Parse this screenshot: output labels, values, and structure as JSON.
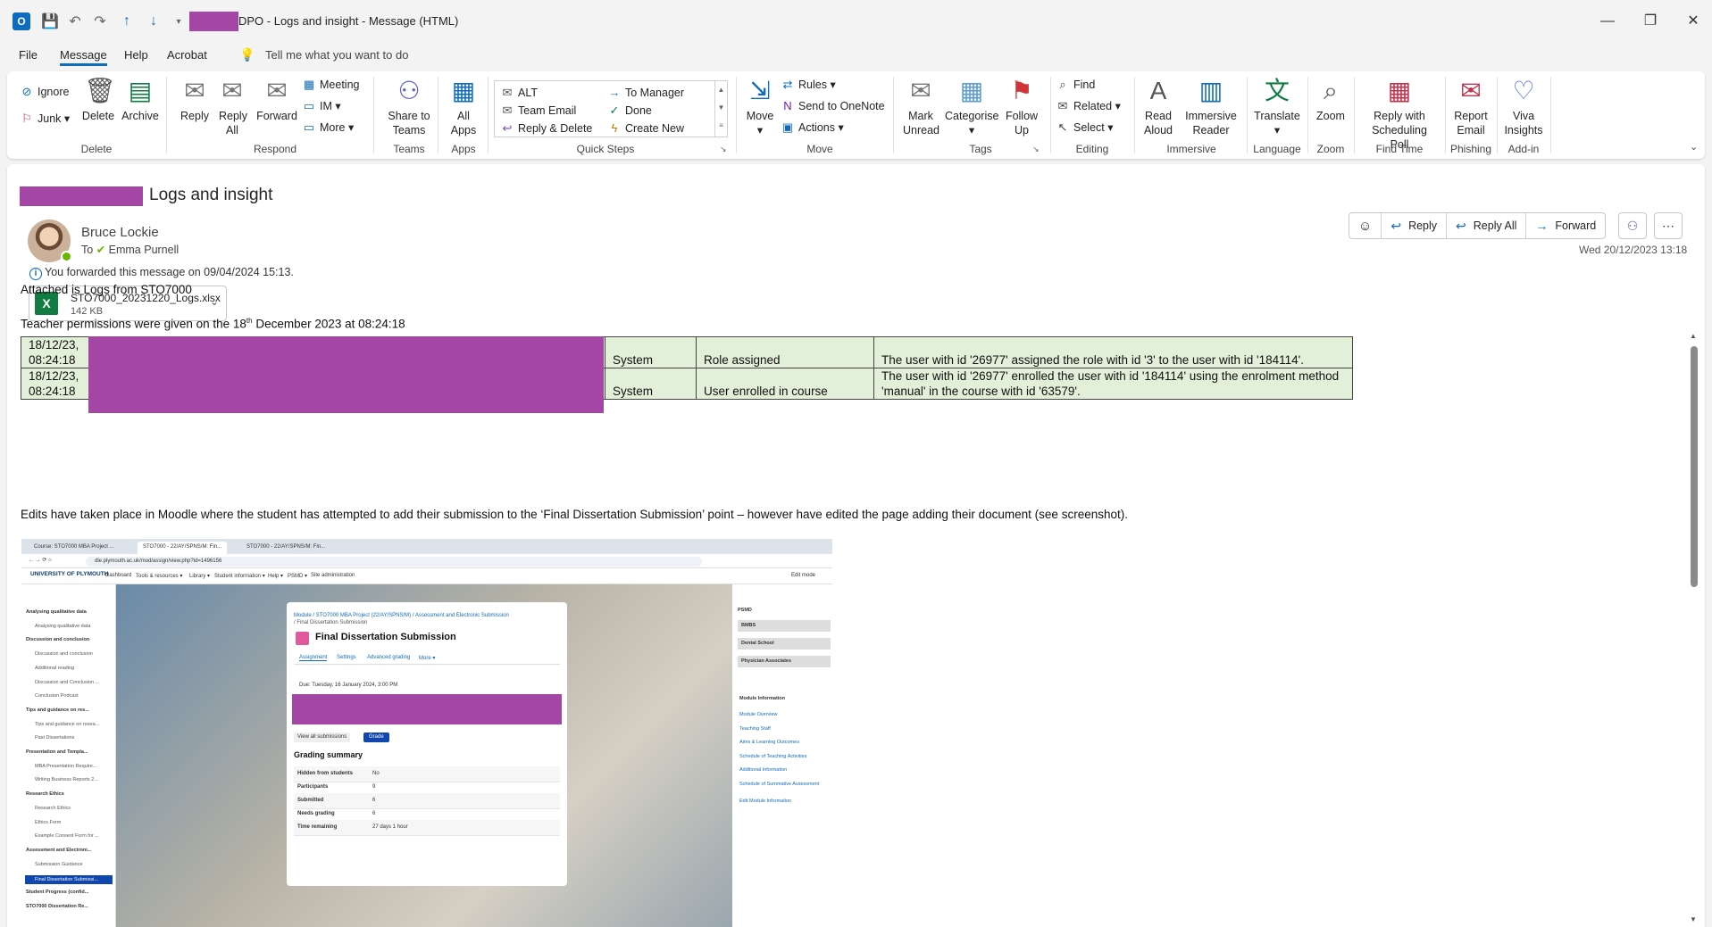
{
  "window": {
    "title": "DPO - Logs and insight  -  Message (HTML)",
    "controls": {
      "minimize": "—",
      "restore": "❐",
      "close": "✕"
    }
  },
  "menu": {
    "tabs": [
      "File",
      "Message",
      "Help",
      "Acrobat"
    ],
    "active": "Message",
    "tell_me": "Tell me what you want to do"
  },
  "ribbon": {
    "delete": {
      "ignore": "Ignore",
      "junk": "Junk",
      "delete": "Delete",
      "archive": "Archive",
      "label": "Delete"
    },
    "respond": {
      "reply": "Reply",
      "reply_all": "Reply All",
      "forward": "Forward",
      "meeting": "Meeting",
      "im": "IM",
      "more": "More",
      "label": "Respond"
    },
    "teams": {
      "share": "Share to Teams",
      "label": "Teams"
    },
    "apps": {
      "all_apps": "All Apps",
      "label": "Apps"
    },
    "quick_steps": {
      "items": [
        "ALT",
        "Team Email",
        "Reply & Delete",
        "To Manager",
        "Done",
        "Create New"
      ],
      "label": "Quick Steps"
    },
    "move": {
      "move": "Move",
      "rules": "Rules",
      "onenote": "Send to OneNote",
      "actions": "Actions",
      "label": "Move"
    },
    "tags": {
      "mark_unread": "Mark Unread",
      "categorise": "Categorise",
      "follow_up": "Follow Up",
      "label": "Tags"
    },
    "editing": {
      "find": "Find",
      "related": "Related",
      "select": "Select",
      "label": "Editing"
    },
    "immersive": {
      "read_aloud": "Read Aloud",
      "immersive_reader": "Immersive Reader",
      "label": "Immersive"
    },
    "language": {
      "translate": "Translate",
      "label": "Language"
    },
    "zoom": {
      "zoom": "Zoom",
      "label": "Zoom"
    },
    "find_time": {
      "poll": "Reply with Scheduling Poll",
      "label": "Find Time"
    },
    "phishing": {
      "report": "Report Email",
      "label": "Phishing"
    },
    "addin": {
      "viva": "Viva Insights",
      "label": "Add-in"
    }
  },
  "message": {
    "subject": "Logs and insight",
    "sender": "Bruce Lockie",
    "to_label": "To",
    "recipient": "Emma Purnell",
    "forwarded_note": "You forwarded this message on 09/04/2024 15:13.",
    "timestamp": "Wed 20/12/2023 13:18",
    "attachment": {
      "name": "STO7000_20231220_Logs.xlsx",
      "size": "142 KB"
    },
    "actions": {
      "reply": "Reply",
      "reply_all": "Reply All",
      "forward": "Forward"
    },
    "body": {
      "line1": "Attached is Logs from STO7000",
      "line2_pre": "Teacher permissions were given on the 18",
      "line2_sup": "th",
      "line2_post": " December 2023 at 08:24:18",
      "line3": "Edits have taken place in Moodle where the student has attempted to add their submission to the ‘Final Dissertation Submission’ point – however have edited the page adding their document (see screenshot)."
    },
    "log_rows": [
      {
        "time": "18/12/23, 08:24:18",
        "origin": "System",
        "event": "Role assigned",
        "description": "The user with id '26977' assigned the role with id '3' to the user with id '184114'."
      },
      {
        "time": "18/12/23, 08:24:18",
        "origin": "System",
        "event": "User enrolled in course",
        "description": "The user with id '26977' enrolled the user with id '184114' using the enrolment method 'manual' in the course with id '63579'."
      }
    ]
  },
  "screenshot": {
    "tabs": [
      "Course: STO7000 MBA Project ...",
      "STO7000 - 22/AY/SPNS/M: Fin...",
      "STO7000 - 22/AY/SPNS/M: Fin..."
    ],
    "url": "dle.plymouth.ac.uk/mod/assign/view.php?id=1496156",
    "logo": "UNIVERSITY OF PLYMOUTH",
    "nav": [
      "Dashboard",
      "Tools & resources ▾",
      "Library ▾",
      "Student information ▾",
      "Help ▾",
      "PSMD ▾",
      "Site administration"
    ],
    "edit_mode": "Edit mode",
    "left_items": [
      {
        "t": "Analysing qualitative data",
        "k": "h"
      },
      {
        "t": "Analysing qualitative data",
        "k": "sub"
      },
      {
        "t": "Discussion and conclusion",
        "k": "h"
      },
      {
        "t": "Discussion and conclusion",
        "k": "sub"
      },
      {
        "t": "Additional reading",
        "k": "sub"
      },
      {
        "t": "Discussion and Conclusion ...",
        "k": "sub"
      },
      {
        "t": "Conclusion Podcast",
        "k": "sub"
      },
      {
        "t": "Tips and guidance on res...",
        "k": "h"
      },
      {
        "t": "Tips and guidance on resea...",
        "k": "sub"
      },
      {
        "t": "Past Dissertations",
        "k": "sub"
      },
      {
        "t": "Presentation and Templa...",
        "k": "h"
      },
      {
        "t": "MBA Presentation Require...",
        "k": "sub"
      },
      {
        "t": "Writing Business Reports 2...",
        "k": "sub"
      },
      {
        "t": "Research Ethics",
        "k": "h"
      },
      {
        "t": "Research Ethics",
        "k": "sub"
      },
      {
        "t": "Ethics Form",
        "k": "sub"
      },
      {
        "t": "Example Consent Form for ...",
        "k": "sub"
      },
      {
        "t": "Assessment and Electroni...",
        "k": "h"
      },
      {
        "t": "Submission Guidance",
        "k": "sub"
      },
      {
        "t": "Final Dissertation Submissi...",
        "k": "sel"
      },
      {
        "t": "Student Progress (confid...",
        "k": "h"
      },
      {
        "t": "STO7000 Dissertation Re...",
        "k": "h"
      }
    ],
    "card": {
      "crumb": "Module  /  STO7000 MBA Project (22/AY/SPNS/M)  /  Assessment and Electronic Submission",
      "crumb2": "/  Final Dissertation Submission",
      "title": "Final Dissertation Submission",
      "tabs": [
        "Assignment",
        "Settings",
        "Advanced grading",
        "More ▾"
      ],
      "due": "Due: Tuesday, 16 January 2024, 3:00 PM",
      "view_all": "View all submissions",
      "grade": "Grade",
      "summary_title": "Grading summary",
      "rows": [
        {
          "k": "Hidden from students",
          "v": "No"
        },
        {
          "k": "Participants",
          "v": "9"
        },
        {
          "k": "Submitted",
          "v": "6"
        },
        {
          "k": "Needs grading",
          "v": "6"
        },
        {
          "k": "Time remaining",
          "v": "27 days 1 hour"
        }
      ]
    },
    "right": {
      "heading": "PSMD",
      "buttons": [
        "BMBS",
        "Dental School",
        "Physician Associates"
      ],
      "module_info": "Module Information",
      "links": [
        "Module Overview",
        "Teaching Staff",
        "Aims & Learning Outcomes",
        "Schedule of Teaching Activities",
        "Additional Information",
        "Schedule of Summative Assessment"
      ],
      "edit": "Edit Module Information"
    }
  },
  "colors": {
    "accent": "#0f6cbd",
    "redaction": "#a446a6",
    "table_fill": "#e2efd9"
  }
}
